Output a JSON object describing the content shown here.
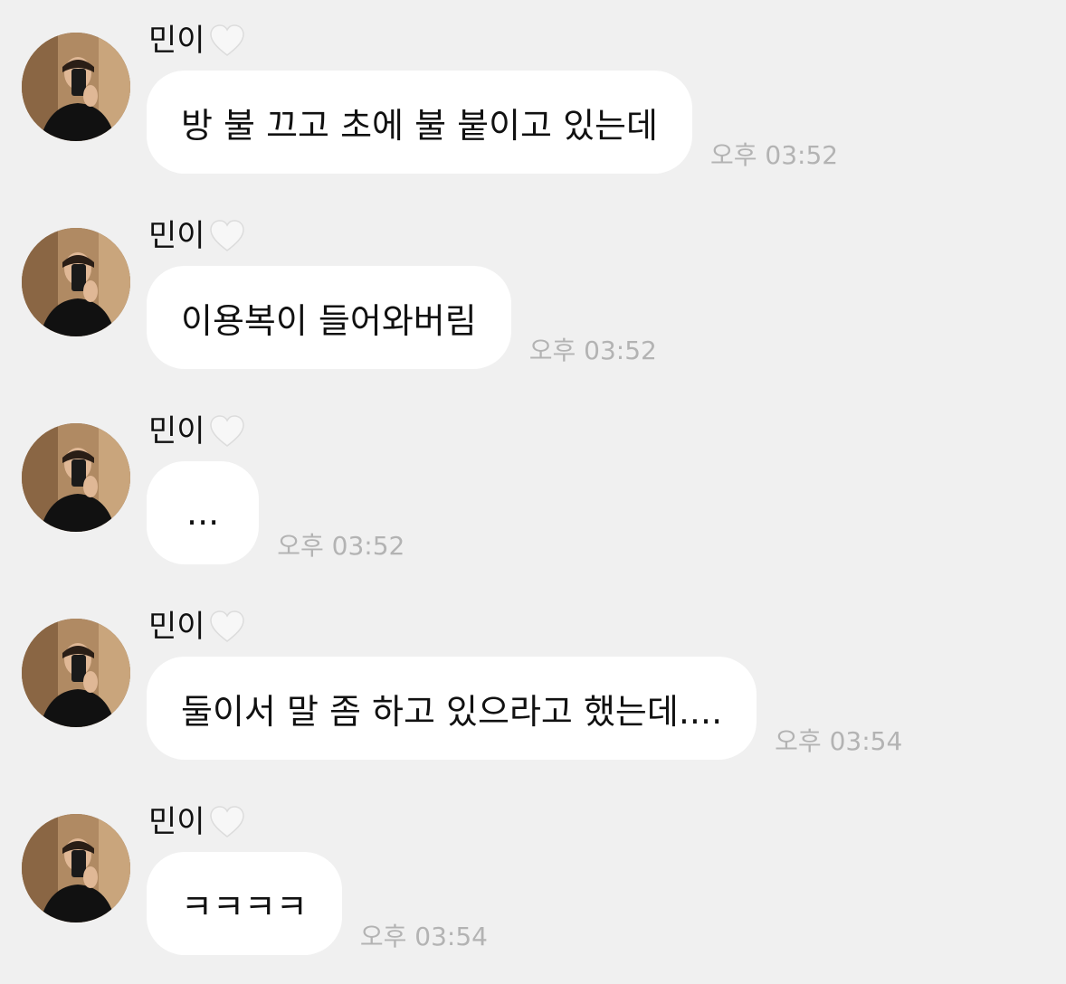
{
  "messages": [
    {
      "sender": "민이",
      "heart_icon": "white-heart-icon",
      "text": "방 불 끄고 초에 불 붙이고 있는데",
      "time": "오후 03:52"
    },
    {
      "sender": "민이",
      "heart_icon": "white-heart-icon",
      "text": "이용복이 들어와버림",
      "time": "오후 03:52"
    },
    {
      "sender": "민이",
      "heart_icon": "white-heart-icon",
      "text": "...",
      "time": "오후 03:52"
    },
    {
      "sender": "민이",
      "heart_icon": "white-heart-icon",
      "text": "둘이서 말 좀 하고 있으라고 했는데....",
      "time": "오후 03:54"
    },
    {
      "sender": "민이",
      "heart_icon": "white-heart-icon",
      "text": "ㅋㅋㅋㅋ",
      "time": "오후 03:54"
    }
  ],
  "colors": {
    "background": "#f0f0f0",
    "bubble": "#ffffff",
    "text": "#111111",
    "timestamp": "#b3b3b3"
  }
}
